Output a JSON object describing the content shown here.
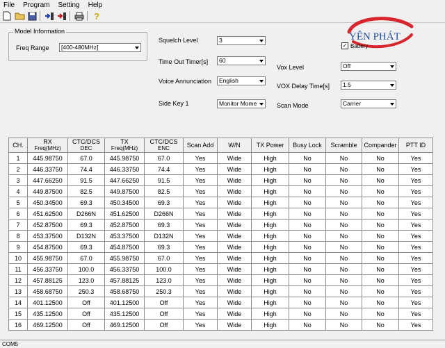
{
  "menu": [
    "File",
    "Program",
    "Setting",
    "Help"
  ],
  "toolbar": {
    "icons": [
      "new-file-icon",
      "open-folder-icon",
      "save-icon",
      "read-radio-icon",
      "write-radio-icon",
      "print-icon",
      "help-icon"
    ]
  },
  "model": {
    "group_title": "Model Information",
    "freq_range_label": "Freq Range",
    "freq_range_value": "[400-480MHz]"
  },
  "settings": {
    "squelch_label": "Squelch Level",
    "squelch_value": "3",
    "timeout_label": "Time Out Timer[s]",
    "timeout_value": "60",
    "voice_label": "Voice Annunciation",
    "voice_value": "English",
    "sidekey_label": "Side Key 1",
    "sidekey_value": "Monitor Momen",
    "vox_label": "Vox Level",
    "vox_value": "Off",
    "voxdelay_label": "VOX Delay Time[s]",
    "voxdelay_value": "1.5",
    "scanmode_label": "Scan Mode",
    "scanmode_value": "Carrier",
    "battery_label": "Battery"
  },
  "logo": {
    "text": "YÊN PHÁT"
  },
  "table": {
    "headers": [
      [
        "CH.",
        ""
      ],
      [
        "RX",
        "Freq(MHz)"
      ],
      [
        "CTC/DCS",
        "DEC"
      ],
      [
        "TX",
        "Freq(MHz)"
      ],
      [
        "CTC/DCS",
        "ENC"
      ],
      [
        "Scan Add",
        ""
      ],
      [
        "W/N",
        ""
      ],
      [
        "TX Power",
        ""
      ],
      [
        "Busy Lock",
        ""
      ],
      [
        "Scramble",
        ""
      ],
      [
        "Compander",
        ""
      ],
      [
        "PTT ID",
        ""
      ]
    ],
    "rows": [
      [
        "1",
        "445.98750",
        "67.0",
        "445.98750",
        "67.0",
        "Yes",
        "Wide",
        "High",
        "No",
        "No",
        "No",
        "Yes"
      ],
      [
        "2",
        "446.33750",
        "74.4",
        "446.33750",
        "74.4",
        "Yes",
        "Wide",
        "High",
        "No",
        "No",
        "No",
        "Yes"
      ],
      [
        "3",
        "447.66250",
        "91.5",
        "447.66250",
        "91.5",
        "Yes",
        "Wide",
        "High",
        "No",
        "No",
        "No",
        "Yes"
      ],
      [
        "4",
        "449.87500",
        "82.5",
        "449.87500",
        "82.5",
        "Yes",
        "Wide",
        "High",
        "No",
        "No",
        "No",
        "Yes"
      ],
      [
        "5",
        "450.34500",
        "69.3",
        "450.34500",
        "69.3",
        "Yes",
        "Wide",
        "High",
        "No",
        "No",
        "No",
        "Yes"
      ],
      [
        "6",
        "451.62500",
        "D266N",
        "451.62500",
        "D266N",
        "Yes",
        "Wide",
        "High",
        "No",
        "No",
        "No",
        "Yes"
      ],
      [
        "7",
        "452.87500",
        "69.3",
        "452.87500",
        "69.3",
        "Yes",
        "Wide",
        "High",
        "No",
        "No",
        "No",
        "Yes"
      ],
      [
        "8",
        "453.37500",
        "D132N",
        "453.37500",
        "D132N",
        "Yes",
        "Wide",
        "High",
        "No",
        "No",
        "No",
        "Yes"
      ],
      [
        "9",
        "454.87500",
        "69.3",
        "454.87500",
        "69.3",
        "Yes",
        "Wide",
        "High",
        "No",
        "No",
        "No",
        "Yes"
      ],
      [
        "10",
        "455.98750",
        "67.0",
        "455.98750",
        "67.0",
        "Yes",
        "Wide",
        "High",
        "No",
        "No",
        "No",
        "Yes"
      ],
      [
        "11",
        "456.33750",
        "100.0",
        "456.33750",
        "100.0",
        "Yes",
        "Wide",
        "High",
        "No",
        "No",
        "No",
        "Yes"
      ],
      [
        "12",
        "457.88125",
        "123.0",
        "457.88125",
        "123.0",
        "Yes",
        "Wide",
        "High",
        "No",
        "No",
        "No",
        "Yes"
      ],
      [
        "13",
        "458.68750",
        "250.3",
        "458.68750",
        "250.3",
        "Yes",
        "Wide",
        "High",
        "No",
        "No",
        "No",
        "Yes"
      ],
      [
        "14",
        "401.12500",
        "Off",
        "401.12500",
        "Off",
        "Yes",
        "Wide",
        "High",
        "No",
        "No",
        "No",
        "Yes"
      ],
      [
        "15",
        "435.12500",
        "Off",
        "435.12500",
        "Off",
        "Yes",
        "Wide",
        "High",
        "No",
        "No",
        "No",
        "Yes"
      ],
      [
        "16",
        "469.12500",
        "Off",
        "469.12500",
        "Off",
        "Yes",
        "Wide",
        "High",
        "No",
        "No",
        "No",
        "Yes"
      ]
    ]
  },
  "status": {
    "port": "COM5"
  },
  "colors": {
    "logo_red": "#d7262e",
    "logo_blue": "#1f4e9c"
  }
}
